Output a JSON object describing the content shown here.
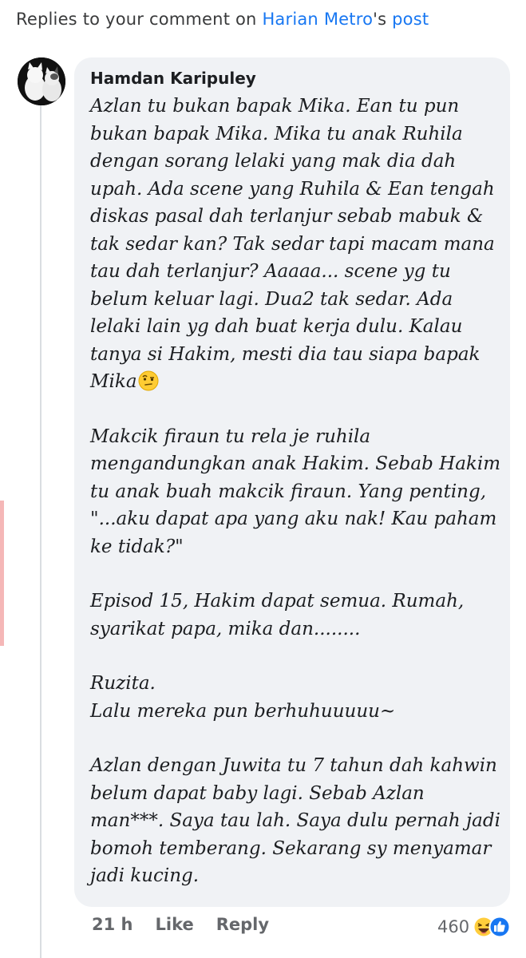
{
  "header": {
    "prefix": "Replies to your comment on ",
    "page_name": "Harian Metro",
    "suffix": "'s ",
    "post_link": "post"
  },
  "comment": {
    "author": "Hamdan Karipuley",
    "paragraph_1": "Azlan tu bukan bapak Mika. Ean tu pun bukan bapak Mika. Mika tu anak Ruhila dengan sorang lelaki yang mak dia dah upah. Ada scene yang Ruhila & Ean tengah diskas pasal dah terlanjur sebab mabuk & tak sedar kan? Tak sedar tapi macam mana tau dah terlanjur? Aaaaa... scene yg tu belum keluar lagi. Dua2 tak sedar. Ada lelaki lain yg dah buat kerja dulu. Kalau tanya si Hakim, mesti dia tau siapa bapak Mika",
    "paragraph_1_emoji": "raised-eyebrow-emoji",
    "paragraph_2": "Makcik firaun tu rela je ruhila mengandungkan anak Hakim. Sebab Hakim tu anak buah makcik firaun. Yang penting, \"...aku dapat apa yang aku nak! Kau paham ke tidak?\"",
    "paragraph_3": "Episod 15, Hakim dapat semua. Rumah, syarikat papa, mika dan........",
    "paragraph_4": "Ruzita.\nLalu mereka pun berhuhuuuuu~",
    "paragraph_5": "Azlan dengan Juwita tu 7 tahun dah kahwin belum dapat baby lagi. Sebab Azlan man***. Saya tau lah. Saya dulu pernah jadi bomoh temberang. Sekarang sy menyamar jadi kucing."
  },
  "actions": {
    "time": "21 h",
    "like": "Like",
    "reply": "Reply"
  },
  "reactions": {
    "count": "460",
    "icons": [
      "laughing-emoji",
      "thumbs-up"
    ]
  },
  "colors": {
    "link": "#1877f2",
    "bubble": "#f0f2f5",
    "meta": "#65676b"
  }
}
